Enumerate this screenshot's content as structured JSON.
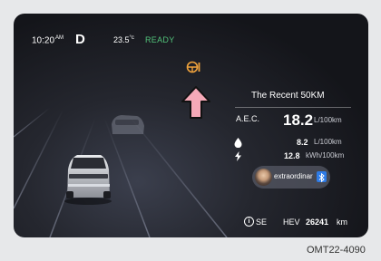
{
  "status_bar": {
    "time": "10:20",
    "ampm": "AM",
    "gear": "D",
    "temperature": "23.5",
    "temperature_unit": "°c",
    "ready": "READY"
  },
  "warning_indicator": {
    "icon": "steering-wheel-warning-icon",
    "color": "#f0a33c"
  },
  "callout_arrow": {
    "icon": "arrow-up-callout-icon",
    "color": "#f5a9b8"
  },
  "stats": {
    "title": "The Recent 50KM",
    "aec_label": "A.E.C.",
    "aec_value": "18.2",
    "aec_unit": "L/100km",
    "fuel_icon": "fuel-drop-icon",
    "fuel_value": "8.2",
    "fuel_unit": "L/100km",
    "electric_icon": "lightning-bolt-icon",
    "electric_value": "12.8",
    "electric_unit": "kWh/100km"
  },
  "media": {
    "track_title": "extraordinar",
    "source_icon": "bluetooth-icon"
  },
  "bottom_bar": {
    "info_icon": "info-icon",
    "compass": "SE",
    "mode": "HEV",
    "odometer_value": "26241",
    "odometer_unit": "km"
  },
  "caption": "OMT22-4090"
}
